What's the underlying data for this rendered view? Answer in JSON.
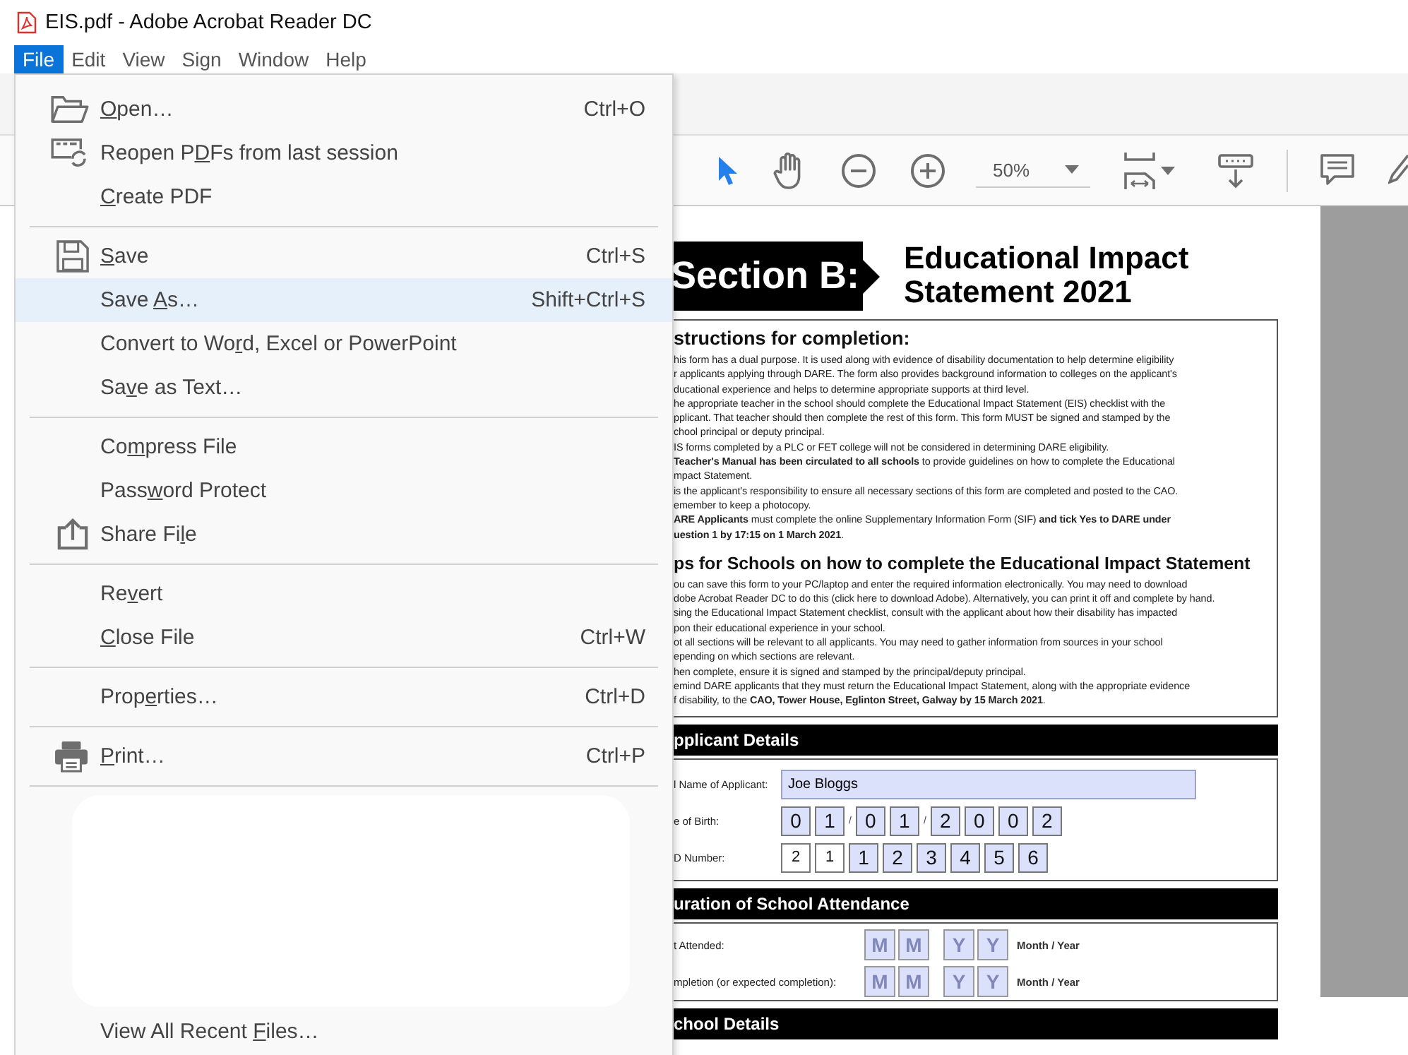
{
  "window": {
    "title": "EIS.pdf - Adobe Acrobat Reader DC"
  },
  "menu_bar": [
    {
      "label": "File",
      "selected": true
    },
    {
      "label": "Edit",
      "selected": false
    },
    {
      "label": "View",
      "selected": false
    },
    {
      "label": "Sign",
      "selected": false
    },
    {
      "label": "Window",
      "selected": false
    },
    {
      "label": "Help",
      "selected": false
    }
  ],
  "file_menu": [
    {
      "kind": "item",
      "key": "O",
      "post": "pen…",
      "shortcut": "Ctrl+O",
      "selected": false
    },
    {
      "kind": "item",
      "pre": "Reopen P",
      "key": "D",
      "post": "Fs from last session",
      "selected": false
    },
    {
      "kind": "item",
      "key": "C",
      "post": "reate PDF",
      "selected": false
    },
    {
      "kind": "separator"
    },
    {
      "kind": "item",
      "key": "S",
      "post": "ave",
      "shortcut": "Ctrl+S",
      "selected": false
    },
    {
      "kind": "item",
      "pre": "Save ",
      "key": "A",
      "post": "s…",
      "shortcut": "Shift+Ctrl+S",
      "selected": true
    },
    {
      "kind": "item",
      "pre": "Convert to Wo",
      "key": "r",
      "post": "d, Excel or PowerPoint",
      "selected": false
    },
    {
      "kind": "item",
      "pre": "Sa",
      "key": "v",
      "post": "e as Text…",
      "selected": false
    },
    {
      "kind": "separator"
    },
    {
      "kind": "item",
      "pre": "Co",
      "key": "m",
      "post": "press File",
      "selected": false
    },
    {
      "kind": "item",
      "pre": "Pass",
      "key": "w",
      "post": "ord Protect",
      "selected": false
    },
    {
      "kind": "item",
      "pre": "Share Fi",
      "key": "l",
      "post": "e",
      "selected": false
    },
    {
      "kind": "separator"
    },
    {
      "kind": "item",
      "pre": "Re",
      "key": "v",
      "post": "ert",
      "selected": false
    },
    {
      "kind": "item",
      "key": "C",
      "post": "lose File",
      "shortcut": "Ctrl+W",
      "selected": false
    },
    {
      "kind": "separator"
    },
    {
      "kind": "item",
      "pre": "Prop",
      "key": "e",
      "post": "rties…",
      "shortcut": "Ctrl+D",
      "selected": false
    },
    {
      "kind": "separator"
    },
    {
      "kind": "item",
      "key": "P",
      "post": "rint…",
      "shortcut": "Ctrl+P",
      "selected": false
    },
    {
      "kind": "separator"
    },
    {
      "kind": "redacted"
    },
    {
      "kind": "item",
      "pre": "View All Recent ",
      "key": "F",
      "post": "iles…",
      "selected": false
    }
  ],
  "toolbar": {
    "tools": [
      {
        "kind": "select",
        "selected": true
      },
      {
        "kind": "hand",
        "selected": false
      }
    ],
    "zoom": "50%"
  },
  "document": {
    "section_label": "Section B:",
    "title": [
      "Educational Impact",
      "Statement 2021"
    ],
    "instructions": {
      "heading": "structions for completion:",
      "lines": [
        "his form has a dual purpose. It is used along with evidence of disability documentation to help determine eligibility",
        "r applicants applying through DARE. The form also provides background information to colleges on the applicant's",
        "ducational experience and helps to determine appropriate supports at third level.",
        "he appropriate teacher in the school should complete the Educational Impact Statement (EIS) checklist with the",
        "pplicant. That teacher should then complete the rest of this form. This form MUST be signed and stamped by the",
        "chool principal or deputy principal.",
        "IS forms completed by a PLC or FET college will not be considered in determining DARE eligibility.",
        "**Teacher's Manual has been circulated to all schools** to provide guidelines on how to complete the Educational",
        "mpact Statement.",
        "is the applicant's responsibility to ensure all necessary sections of this form are completed and posted to the CAO.",
        "emember to keep a photocopy.",
        "**ARE Applicants** must complete the online Supplementary Information Form (SIF) **and tick Yes to DARE under**",
        "**uestion 1 by 17:15 on 1 March 2021**."
      ]
    },
    "tips": {
      "heading": "ps for Schools on how to complete the Educational Impact Statement",
      "lines": [
        "ou can save this form to your PC/laptop and enter the required information electronically. You may need to download",
        "dobe Acrobat Reader DC to do this (click here to download Adobe). Alternatively, you can print it off and complete by hand.",
        "sing the Educational Impact Statement checklist, consult with the applicant about how their disability has impacted",
        "pon their educational experience in your school.",
        "ot all sections will be relevant to all applicants. You may need to gather information from sources in your school",
        "epending on which sections are relevant.",
        "hen complete, ensure it is signed and stamped by the principal/deputy principal.",
        "emind DARE applicants that they must return the Educational Impact Statement, along with the appropriate evidence",
        "f disability, to the **CAO, Tower House, Eglinton Street, Galway by 15 March 2021**."
      ]
    },
    "applicant": {
      "heading": "pplicant Details",
      "name_label": "l Name of Applicant:",
      "name_value": "Joe Bloggs",
      "dob_label": "e of Birth:",
      "dob": [
        {
          "kind": "digit",
          "value": "0"
        },
        {
          "kind": "digit",
          "value": "1"
        },
        {
          "kind": "sep",
          "value": "/"
        },
        {
          "kind": "digit",
          "value": "0"
        },
        {
          "kind": "digit",
          "value": "1"
        },
        {
          "kind": "sep",
          "value": "/"
        },
        {
          "kind": "digit",
          "value": "2"
        },
        {
          "kind": "digit",
          "value": "0"
        },
        {
          "kind": "digit",
          "value": "0"
        },
        {
          "kind": "digit",
          "value": "2"
        }
      ],
      "id_label": "D Number:",
      "id": [
        {
          "kind": "plain",
          "value": "2"
        },
        {
          "kind": "plain",
          "value": "1"
        },
        {
          "kind": "digit",
          "value": "1"
        },
        {
          "kind": "digit",
          "value": "2"
        },
        {
          "kind": "digit",
          "value": "3"
        },
        {
          "kind": "digit",
          "value": "4"
        },
        {
          "kind": "digit",
          "value": "5"
        },
        {
          "kind": "digit",
          "value": "6"
        }
      ]
    },
    "attendance": {
      "heading": "uration of School Attendance",
      "rows": [
        {
          "label": "t Attended:",
          "boxes": [
            {
              "placeholder": "M"
            },
            {
              "placeholder": "M"
            },
            {
              "placeholder": "Y"
            },
            {
              "placeholder": "Y"
            }
          ],
          "unit": "Month / Year"
        },
        {
          "label": "mpletion (or expected completion):",
          "boxes": [
            {
              "placeholder": "M"
            },
            {
              "placeholder": "M"
            },
            {
              "placeholder": "Y"
            },
            {
              "placeholder": "Y"
            }
          ],
          "unit": "Month / Year"
        }
      ]
    },
    "school_heading": "chool Details"
  }
}
